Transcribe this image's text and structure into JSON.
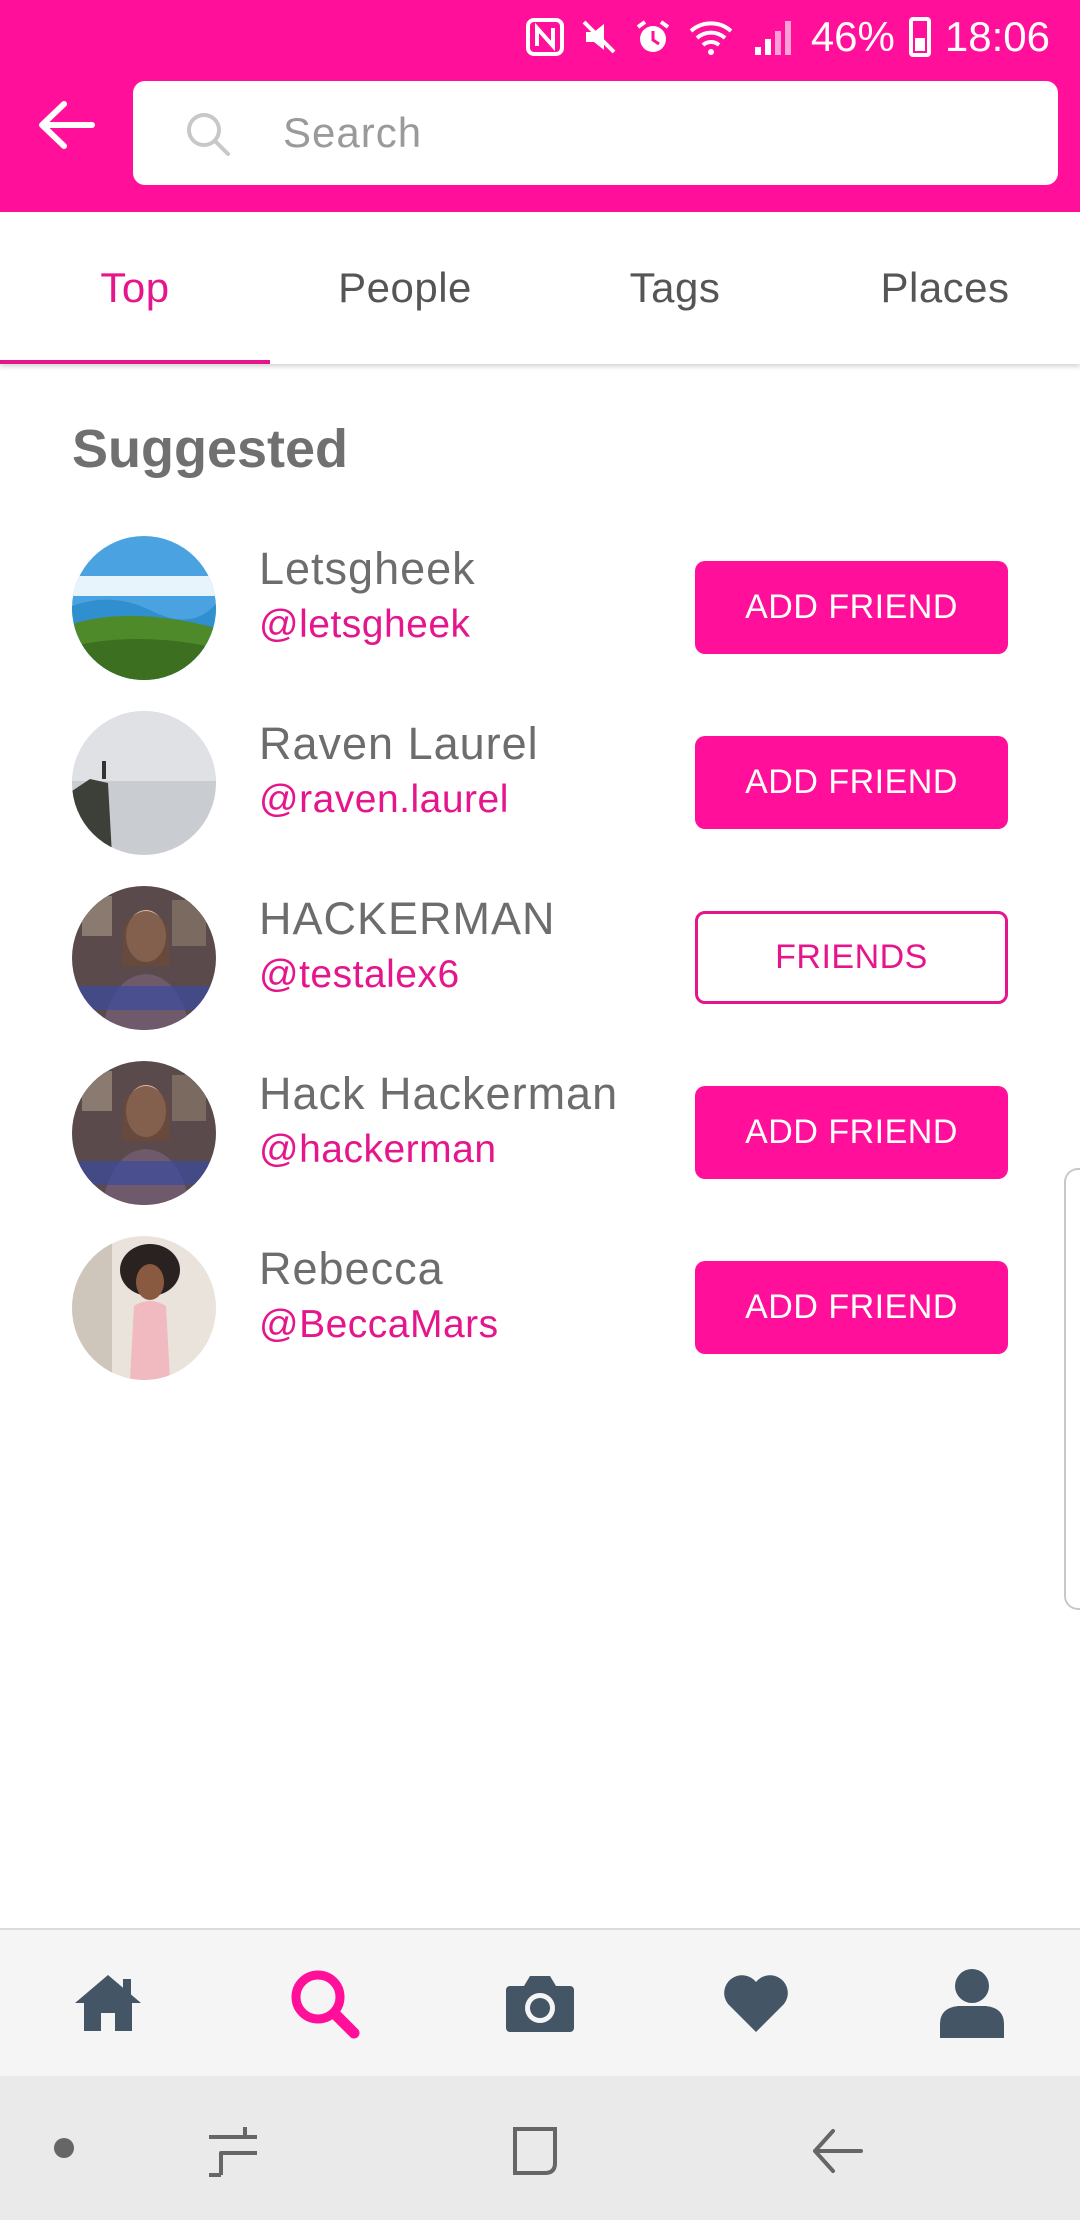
{
  "status_bar": {
    "battery": "46%",
    "time": "18:06",
    "icons": [
      "nfc-icon",
      "mute-icon",
      "alarm-icon",
      "wifi-icon",
      "signal-icon",
      "battery-icon"
    ]
  },
  "header": {
    "back_icon": "arrow-left-icon",
    "search_placeholder": "Search",
    "search_value": ""
  },
  "tabs": [
    {
      "label": "Top",
      "active": true
    },
    {
      "label": "People",
      "active": false
    },
    {
      "label": "Tags",
      "active": false
    },
    {
      "label": "Places",
      "active": false
    }
  ],
  "suggested": {
    "title": "Suggested",
    "users": [
      {
        "name": "Letsgheek",
        "handle": "@letsgheek",
        "action": "ADD FRIEND"
      },
      {
        "name": "Raven Laurel",
        "handle": "@raven.laurel",
        "action": "ADD FRIEND"
      },
      {
        "name": "HACKERMAN",
        "handle": "@testalex6",
        "action": "FRIENDS"
      },
      {
        "name": "Hack Hackerman",
        "handle": "@hackerman",
        "action": "ADD FRIEND"
      },
      {
        "name": "Rebecca",
        "handle": "@BeccaMars",
        "action": "ADD FRIEND"
      }
    ]
  },
  "bottom_nav": [
    {
      "icon": "home-icon",
      "active": false
    },
    {
      "icon": "search-icon",
      "active": true
    },
    {
      "icon": "camera-icon",
      "active": false
    },
    {
      "icon": "heart-icon",
      "active": false
    },
    {
      "icon": "profile-icon",
      "active": false
    }
  ],
  "colors": {
    "accent": "#ff0f9a",
    "accent_text": "#e5168c",
    "icon_dark": "#445566"
  }
}
